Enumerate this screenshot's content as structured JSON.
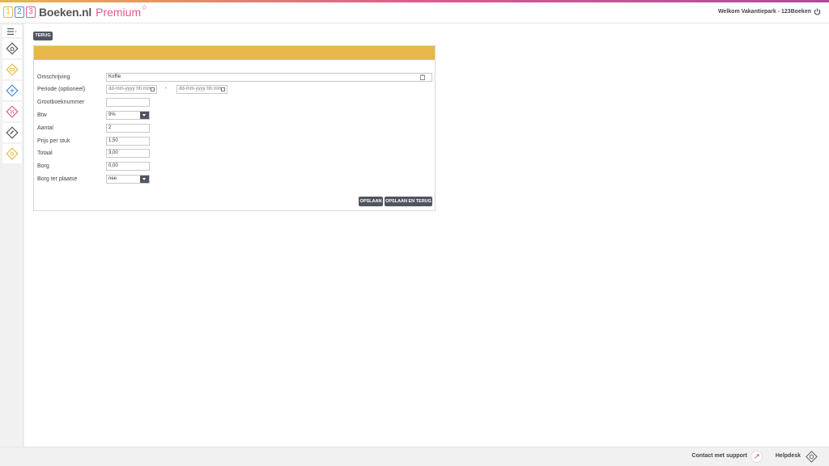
{
  "header": {
    "logo_1": "1",
    "logo_2": "2",
    "logo_3": "3",
    "brand": "Boeken.nl",
    "premium": "Premium",
    "star": "☆",
    "welcome": "Welkom Vakantiepark - 123Boeken"
  },
  "sidebar": {
    "items": [
      "home-icon",
      "pricing-icon",
      "move-icon",
      "discount-icon",
      "ticket-icon",
      "settings-icon"
    ]
  },
  "buttons": {
    "back": "TERUG",
    "save": "OPSLAAN",
    "save_back": "OPSLAAN EN TERUG"
  },
  "form": {
    "omschrijving": {
      "label": "Omschrijving",
      "value": "Koffie"
    },
    "periode": {
      "label": "Periode (optioneel)",
      "from_placeholder": "dd-mm-yyyy hh:mm",
      "separator": "-",
      "to_placeholder": "dd-mm-yyyy hh:mm"
    },
    "grootboek": {
      "label": "Grootboeknummer",
      "value": ""
    },
    "btw": {
      "label": "Btw",
      "value": "9%"
    },
    "aantal": {
      "label": "Aantal",
      "value": "2"
    },
    "prijs": {
      "label": "Prijs per stuk",
      "value": "1,50"
    },
    "totaal": {
      "label": "Totaal",
      "value": "3,00"
    },
    "borg": {
      "label": "Borg",
      "value": "0,00"
    },
    "borg_ter_plaatse": {
      "label": "Borg ter plaatse",
      "value": "nee"
    }
  },
  "footer": {
    "support": "Contact met support",
    "helpdesk": "Helpdesk"
  },
  "colors": {
    "accent_yellow": "#e7b74c",
    "accent_pink": "#e05a8e",
    "accent_blue": "#4a8ad4",
    "button_dark": "#505560"
  }
}
